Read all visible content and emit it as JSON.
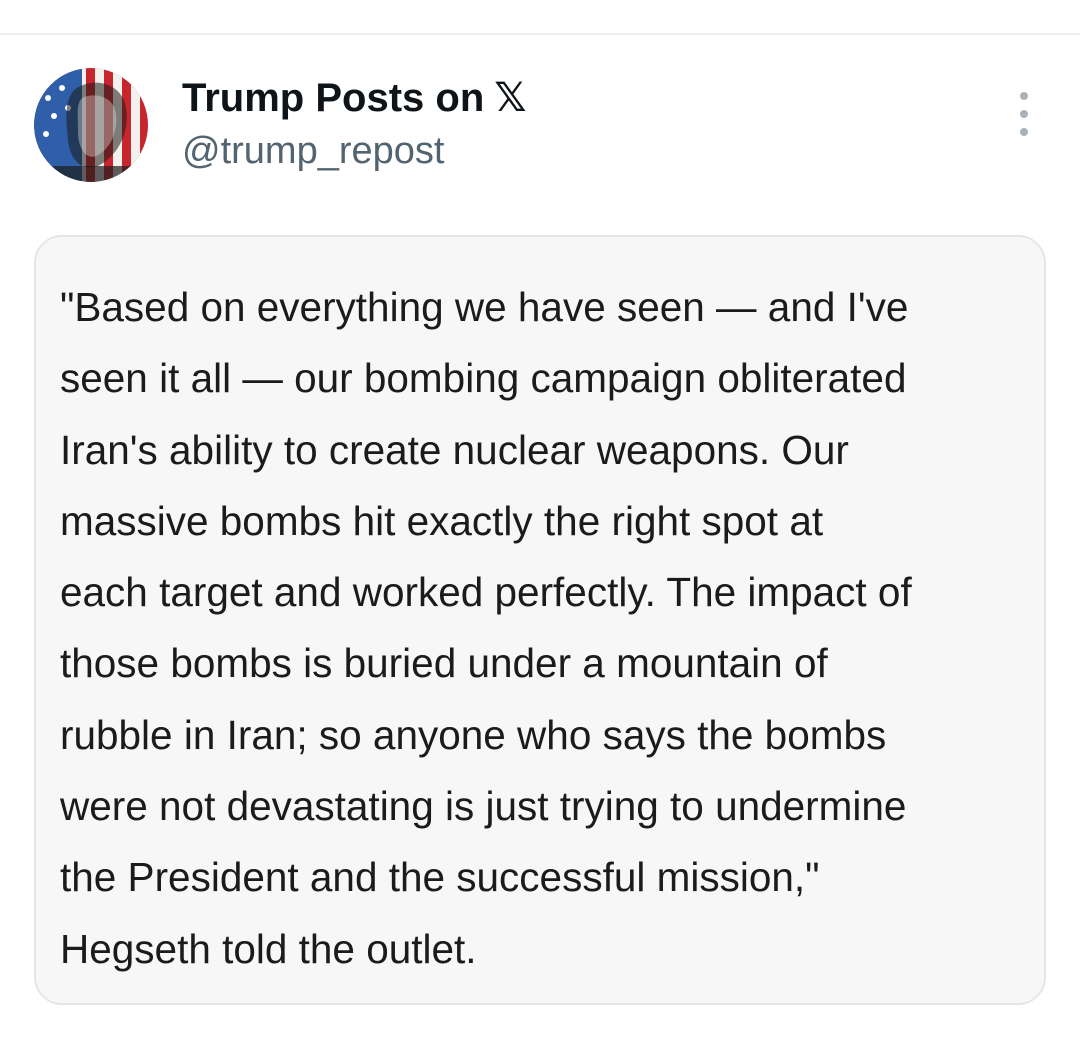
{
  "post": {
    "author": {
      "display_name": "Trump Posts on",
      "platform_mark": "𝕏",
      "handle": "@trump_repost",
      "avatar_icon": "flag-portrait-avatar"
    },
    "menu_icon": "more-vertical-icon",
    "quote": {
      "lines": [
        "\"Based on everything we have seen — and I've",
        "seen it all — our bombing campaign obliterated",
        "Iran's ability to create nuclear weapons. Our",
        "massive bombs hit exactly the right spot at",
        "each target and worked perfectly. The impact of",
        "those bombs is buried under a mountain of",
        "rubble in Iran; so anyone who says the bombs",
        "were not devastating is just trying to undermine",
        "the President and the successful mission,\"",
        "Hegseth told the outlet."
      ]
    }
  },
  "colors": {
    "background": "#ffffff",
    "card_background": "#f7f7f7",
    "card_border": "#e4e6e8",
    "name_text": "#0f1419",
    "handle_text": "#536471",
    "quote_text": "#1b1b1b"
  }
}
